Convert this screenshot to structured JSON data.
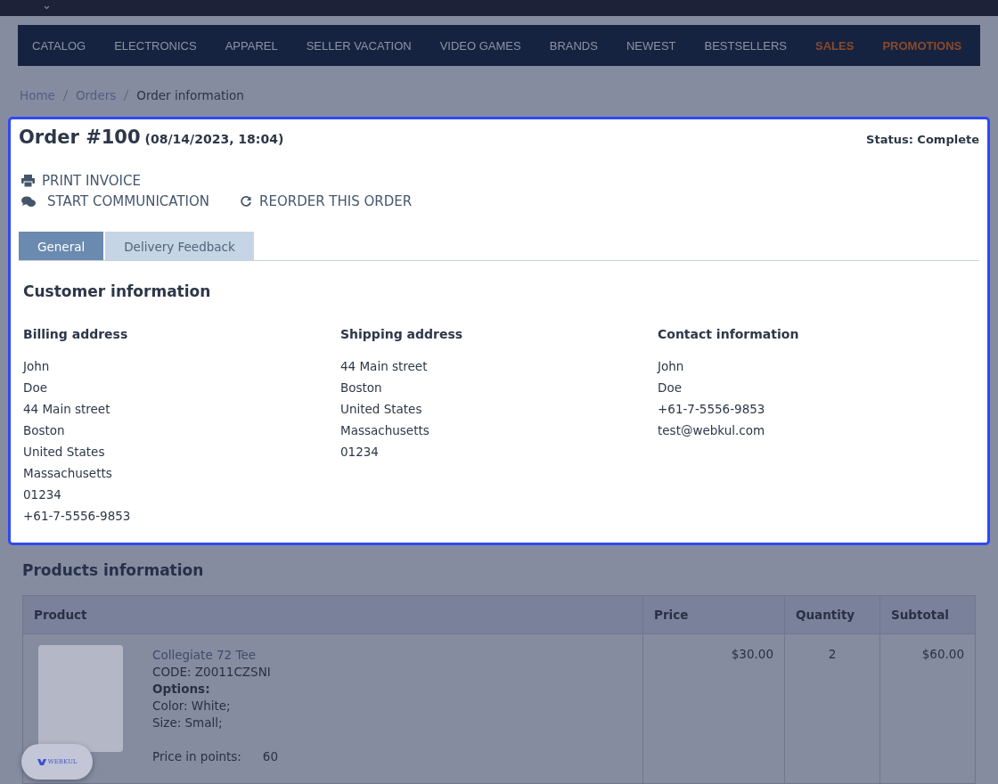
{
  "top_bar": {
    "caret": "⌄"
  },
  "nav": [
    {
      "label": "CATALOG",
      "highlight": false
    },
    {
      "label": "ELECTRONICS",
      "highlight": false
    },
    {
      "label": "APPAREL",
      "highlight": false
    },
    {
      "label": "SELLER VACATION",
      "highlight": false
    },
    {
      "label": "VIDEO GAMES",
      "highlight": false
    },
    {
      "label": "BRANDS",
      "highlight": false
    },
    {
      "label": "NEWEST",
      "highlight": false
    },
    {
      "label": "BESTSELLERS",
      "highlight": false
    },
    {
      "label": "SALES",
      "highlight": true
    },
    {
      "label": "PROMOTIONS",
      "highlight": true
    }
  ],
  "breadcrumbs": [
    {
      "label": "Home",
      "kind": "link"
    },
    {
      "label": "Orders",
      "kind": "link"
    },
    {
      "label": "Order information",
      "kind": "current"
    }
  ],
  "order": {
    "title": "Order #100",
    "date": "(08/14/2023, 18:04)",
    "status": "Status: Complete",
    "actions": [
      {
        "label": "PRINT INVOICE",
        "kind": "print"
      },
      {
        "label": "START COMMUNICATION",
        "kind": "chat"
      },
      {
        "label": "REORDER THIS ORDER",
        "kind": "reorder"
      }
    ],
    "tabs": [
      {
        "label": "General",
        "selected": true
      },
      {
        "label": "Delivery Feedback",
        "selected": false
      }
    ],
    "section_title": "Customer information",
    "columns": [
      {
        "heading": "Billing address",
        "lines": [
          "John",
          "Doe",
          "44 Main street",
          "Boston",
          "United States",
          "Massachusetts",
          "01234",
          "+61-7-5556-9853"
        ]
      },
      {
        "heading": "Shipping address",
        "lines": [
          "44 Main street",
          "Boston",
          "United States",
          "Massachusetts",
          "01234"
        ]
      },
      {
        "heading": "Contact information",
        "lines": [
          "John",
          "Doe",
          "+61-7-5556-9853",
          "test@webkul.com"
        ]
      }
    ]
  },
  "products": {
    "title": "Products information",
    "columns": [
      "Product",
      "Price",
      "Quantity",
      "Subtotal"
    ],
    "rows": [
      {
        "name": "Collegiate 72 Tee",
        "code": "CODE: Z0011CZSNI",
        "options_label": "Options:",
        "options": [
          "Color: White;",
          "Size: Small;"
        ],
        "points_label": "Price in points:",
        "points": "60",
        "price": "$30.00",
        "quantity": "2",
        "subtotal": "$60.00"
      }
    ]
  },
  "badge": {
    "label": "WEBKUL"
  }
}
